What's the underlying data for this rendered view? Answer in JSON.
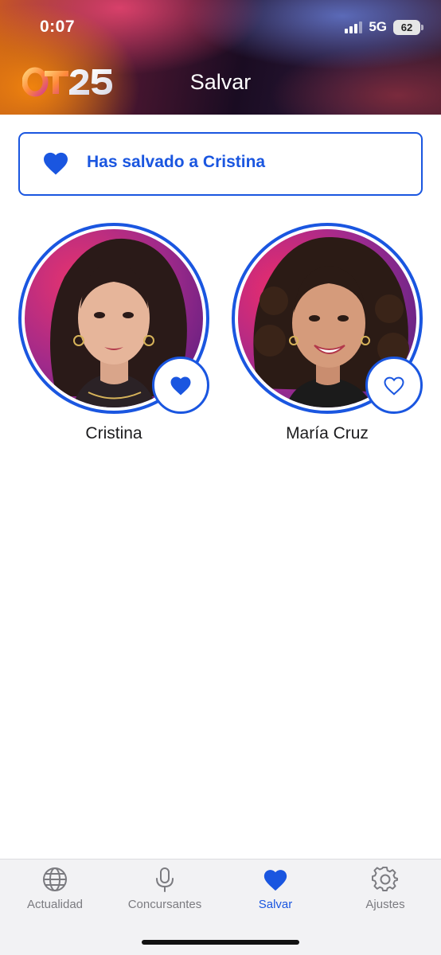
{
  "status_bar": {
    "time": "0:07",
    "network": "5G",
    "battery": "62"
  },
  "header": {
    "logo_text": "OT25",
    "title": "Salvar"
  },
  "banner": {
    "icon": "heart-filled-icon",
    "message": "Has salvado a Cristina"
  },
  "contestants": [
    {
      "name": "Cristina",
      "saved": true,
      "button_icon": "heart-filled-icon"
    },
    {
      "name": "María Cruz",
      "saved": false,
      "button_icon": "heart-outline-icon"
    }
  ],
  "tabbar": {
    "items": [
      {
        "label": "Actualidad",
        "icon": "globe-icon",
        "active": false
      },
      {
        "label": "Concursantes",
        "icon": "microphone-icon",
        "active": false
      },
      {
        "label": "Salvar",
        "icon": "heart-filled-icon",
        "active": true
      },
      {
        "label": "Ajustes",
        "icon": "gear-icon",
        "active": false
      }
    ]
  },
  "colors": {
    "accent": "#1a56e0",
    "inactive_tab": "#7b7b80",
    "tabbar_bg": "#f2f2f4"
  }
}
